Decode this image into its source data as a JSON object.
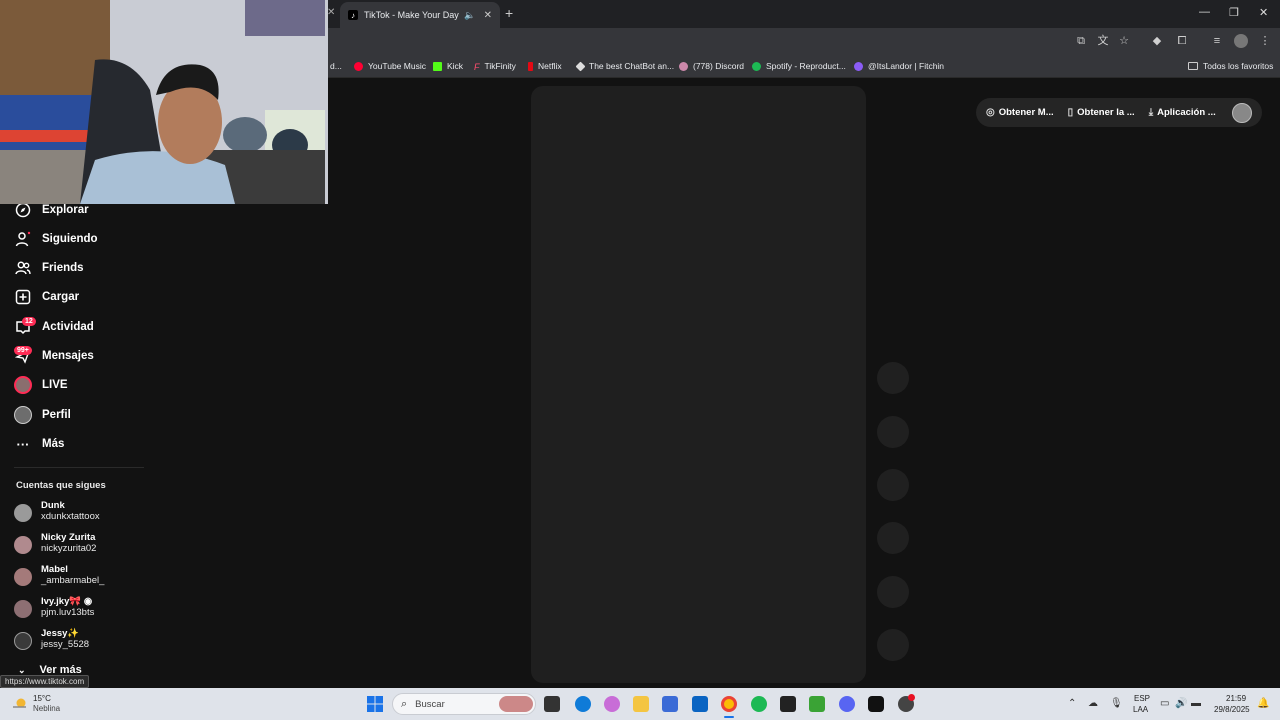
{
  "browser": {
    "tab_title": "TikTok - Make Your Day",
    "bookmarks": [
      "d...",
      "YouTube Music",
      "Kick",
      "TikFinity",
      "Netflix",
      "The best ChatBot an...",
      "(778) Discord",
      "Spotify - Reproduct...",
      "@ItsLandor | Fitchin",
      "Todos los favoritos"
    ],
    "status_url": "https://www.tiktok.com"
  },
  "sidebar": {
    "items": [
      {
        "label": "Explorar",
        "icon": "compass-icon"
      },
      {
        "label": "Siguiendo",
        "icon": "person-follow-icon"
      },
      {
        "label": "Friends",
        "icon": "friends-icon"
      },
      {
        "label": "Cargar",
        "icon": "upload-icon"
      },
      {
        "label": "Actividad",
        "icon": "inbox-icon",
        "badge": "12"
      },
      {
        "label": "Mensajes",
        "icon": "message-icon",
        "badge": "99+"
      },
      {
        "label": "LIVE",
        "icon": "live-avatar-icon"
      },
      {
        "label": "Perfil",
        "icon": "profile-avatar-icon"
      },
      {
        "label": "Más",
        "icon": "more-icon"
      }
    ],
    "following_title": "Cuentas que sigues",
    "accounts": [
      {
        "name": "Dunk",
        "username": "xdunkxtattoox"
      },
      {
        "name": "Nicky Zurita",
        "username": "nickyzurita02"
      },
      {
        "name": "Mabel",
        "username": "_ambarmabel_"
      },
      {
        "name": "Ivy.jky🎀 ◉",
        "username": "pjm.luv13bts"
      },
      {
        "name": "Jessy✨",
        "username": "jessy_5528"
      }
    ],
    "see_more": "Ver más"
  },
  "top_pill": {
    "items": [
      "Obtener M...",
      "Obtener la ...",
      "Aplicación ..."
    ]
  },
  "taskbar": {
    "temperature": "15°C",
    "weather": "Neblina",
    "search_placeholder": "Buscar",
    "lang_top": "ESP",
    "lang_bottom": "LAA",
    "time": "21:59",
    "date": "29/8/2025"
  },
  "colors": {
    "accent": "#fe2c55",
    "background": "#121212",
    "panel": "#1f1f1f"
  }
}
